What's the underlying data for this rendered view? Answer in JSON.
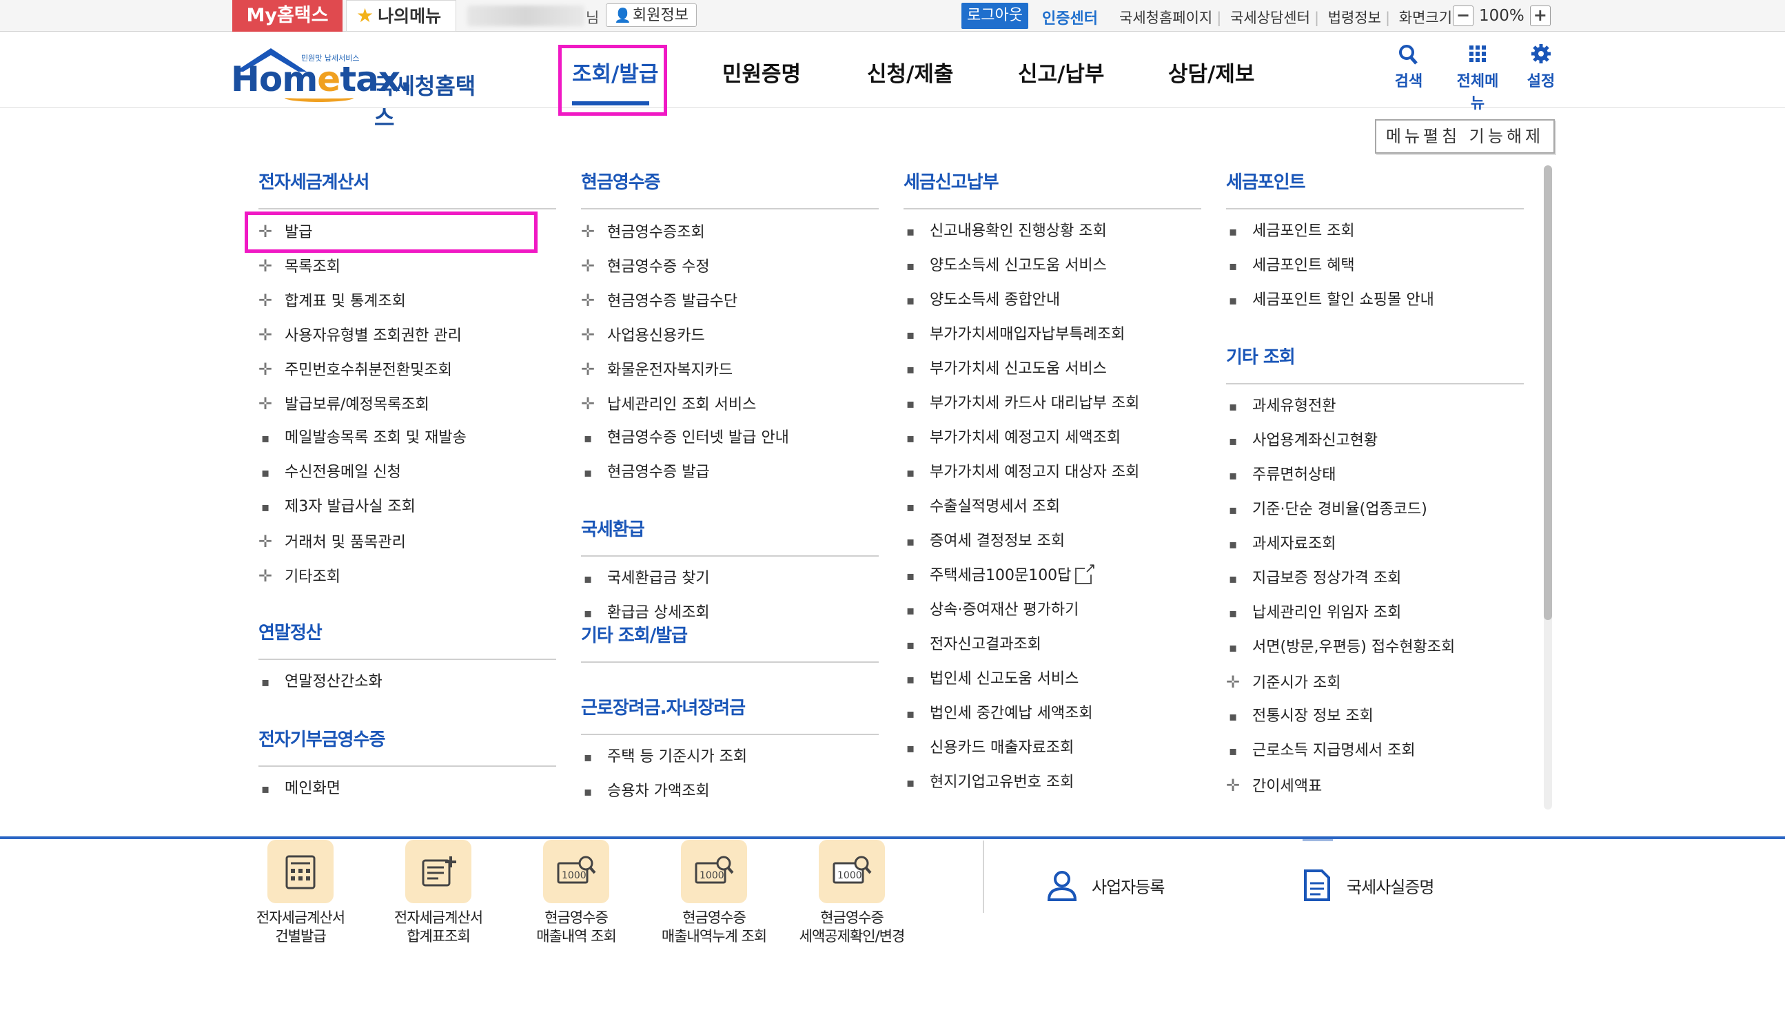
{
  "topbar": {
    "my_hometax": "My홈택스",
    "my_menu": "나의메뉴",
    "user_suffix": "님",
    "member_info": "회원정보",
    "logout": "로그아웃",
    "cert_center": "인증센터",
    "links": [
      "국세청홈페이지",
      "국세상담센터",
      "법령정보",
      "화면크기"
    ],
    "zoom_minus": "−",
    "zoom_value": "100%",
    "zoom_plus": "+"
  },
  "header": {
    "logo_sub": "민원맛 납세서비스",
    "logo_word_1": "Hom",
    "logo_word_e": "e",
    "logo_word_2": "tax.",
    "logo_korean": "국세청홈택스",
    "gnb": [
      "조회/발급",
      "민원증명",
      "신청/제출",
      "신고/납부",
      "상담/제보"
    ],
    "icons": [
      {
        "label": "검색",
        "icon": "search-icon"
      },
      {
        "label": "전체메뉴",
        "icon": "grid-icon"
      },
      {
        "label": "설정",
        "icon": "gear-icon"
      }
    ]
  },
  "panel": {
    "fold_button": "메뉴펼침 기능해제",
    "col1": {
      "sec1_title": "전자세금계산서",
      "sec1_items": [
        "발급",
        "목록조회",
        "합계표 및 통계조회",
        "사용자유형별 조회권한 관리",
        "주민번호수취분전환및조회",
        "발급보류/예정목록조회",
        "메일발송목록 조회 및 재발송",
        "수신전용메일 신청",
        "제3자 발급사실 조회",
        "거래처 및 품목관리",
        "기타조회"
      ],
      "sec2_title": "연말정산",
      "sec2_items": [
        "연말정산간소화"
      ],
      "sec3_title": "전자기부금영수증",
      "sec3_items": [
        "메인화면"
      ]
    },
    "col2": {
      "sec1_title": "현금영수증",
      "sec1_items": [
        "현금영수증조회",
        "현금영수증 수정",
        "현금영수증 발급수단",
        "사업용신용카드",
        "화물운전자복지카드",
        "납세관리인 조회 서비스",
        "현금영수증 인터넷 발급 안내",
        "현금영수증 발급"
      ],
      "sec2_title": "국세환급",
      "sec2_items": [
        "국세환급금 찾기",
        "환급금 상세조회"
      ],
      "sec3_title": "기타 조회/발급",
      "sec4_title": "근로장려금.자녀장려금",
      "sec4_items": [
        "주택 등 기준시가 조회",
        "승용차 가액조회"
      ]
    },
    "col3": {
      "sec1_title": "세금신고납부",
      "sec1_items": [
        "신고내용확인 진행상황 조회",
        "양도소득세 신고도움 서비스",
        "양도소득세 종합안내",
        "부가가치세매입자납부특례조회",
        "부가가치세 신고도움 서비스",
        "부가가치세 카드사 대리납부 조회",
        "부가가치세 예정고지 세액조회",
        "부가가치세 예정고지 대상자 조회",
        "수출실적명세서 조회",
        "증여세 결정정보 조회",
        "주택세금100문100답",
        "상속·증여재산 평가하기",
        "전자신고결과조회",
        "법인세 신고도움 서비스",
        "법인세 중간예납 세액조회",
        "신용카드 매출자료조회",
        "현지기업고유번호 조회"
      ]
    },
    "col4": {
      "sec1_title": "세금포인트",
      "sec1_items": [
        "세금포인트 조회",
        "세금포인트 혜택",
        "세금포인트 할인 쇼핑몰 안내"
      ],
      "sec2_title": "기타 조회",
      "sec2_items": [
        "과세유형전환",
        "사업용계좌신고현황",
        "주류면허상태",
        "기준·단순 경비율(업종코드)",
        "과세자료조회",
        "지급보증 정상가격 조회",
        "납세관리인 위임자 조회",
        "서면(방문,우편등) 접수현황조회",
        "기준시가 조회",
        "전통시장 정보 조회",
        "근로소득 지급명세서 조회",
        "간이세액표"
      ]
    }
  },
  "quick": {
    "tiles": [
      {
        "line1": "전자세금계산서",
        "line2": "건별발급",
        "icon": "invoice-calculator-icon"
      },
      {
        "line1": "전자세금계산서",
        "line2": "합계표조회",
        "icon": "invoice-summary-icon"
      },
      {
        "line1": "현금영수증",
        "line2": "매출내역 조회",
        "icon": "receipt-search-icon"
      },
      {
        "line1": "현금영수증",
        "line2": "매출내역누계 조회",
        "icon": "receipt-total-icon"
      },
      {
        "line1": "현금영수증",
        "line2": "세액공제확인/변경",
        "icon": "receipt-deduction-icon"
      }
    ],
    "links": [
      {
        "label": "사업자등록",
        "icon": "person-icon"
      },
      {
        "label": "국세사실증명",
        "icon": "document-icon"
      }
    ]
  },
  "colors": {
    "brand_blue": "#1a56b8",
    "highlight_magenta": "#f019c4",
    "my_hometax_red": "#e04a4f",
    "quick_tile_bg": "#fbe7c1"
  }
}
